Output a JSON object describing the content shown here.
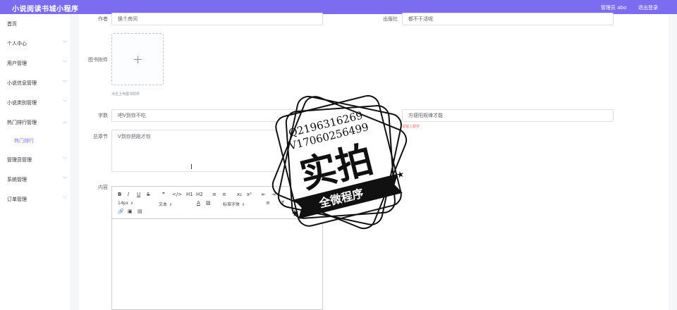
{
  "header": {
    "title": "小说阅读书城小程序",
    "admin": "管理员 abo",
    "logout": "退出登录"
  },
  "sidebar": {
    "items": [
      {
        "label": "首页"
      },
      {
        "label": "个人中心"
      },
      {
        "label": "用户管理"
      },
      {
        "label": "小说信息管理"
      },
      {
        "label": "小说类别管理"
      },
      {
        "label": "热门排行管理"
      },
      {
        "label": "热门排行"
      },
      {
        "label": "管理员管理"
      },
      {
        "label": "系统管理"
      },
      {
        "label": "订单管理"
      }
    ]
  },
  "form": {
    "author": {
      "label": "作者",
      "value": "换个房间"
    },
    "publisher": {
      "label": "出版社",
      "value": "都不干活呢"
    },
    "attachment": {
      "label": "图书附件",
      "tip": "点击上传图书附件"
    },
    "word_count": {
      "label": "字数",
      "value": "吧V到你不吃"
    },
    "field_right2": {
      "value": "方便阳规律才能",
      "error": "请输入数字"
    },
    "chapters": {
      "label": "总章节",
      "value": "V到你把刚才你"
    },
    "content": {
      "label": "内容"
    }
  },
  "editor": {
    "buttons": [
      "B",
      "I",
      "U",
      "S",
      "❞",
      "</>",
      "H1",
      "H2",
      "≡",
      "≡",
      "x₂",
      "x²",
      "⇤",
      "⇥"
    ],
    "font_size": "14px",
    "text_type": "文本",
    "font_family": "标准字体"
  },
  "watermark": {
    "line1": "Q2196316269",
    "line2": "V17060256499",
    "main": "实拍",
    "banner": "全微程序"
  }
}
